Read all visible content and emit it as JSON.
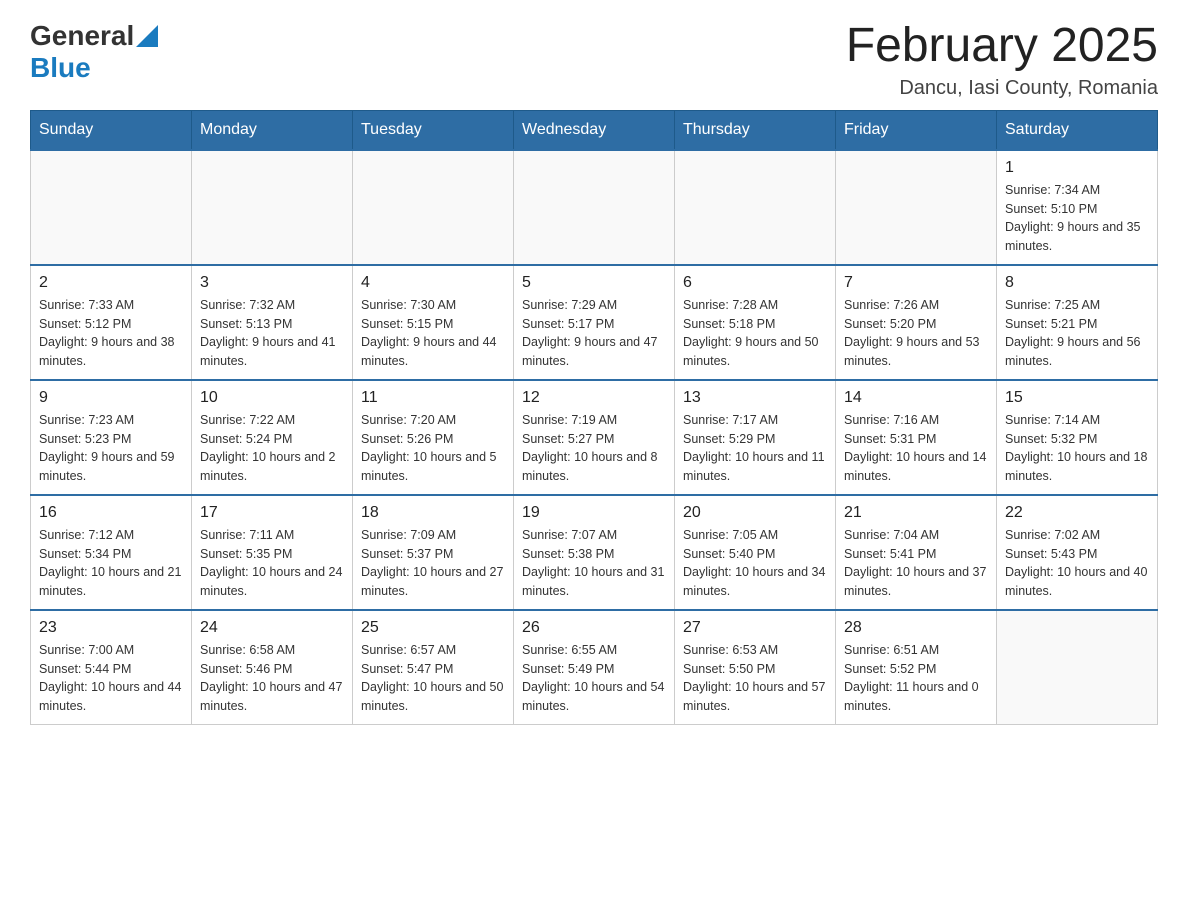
{
  "header": {
    "logo_general": "General",
    "logo_blue": "Blue",
    "title": "February 2025",
    "subtitle": "Dancu, Iasi County, Romania"
  },
  "days_of_week": [
    "Sunday",
    "Monday",
    "Tuesday",
    "Wednesday",
    "Thursday",
    "Friday",
    "Saturday"
  ],
  "weeks": [
    [
      {
        "day": "",
        "info": ""
      },
      {
        "day": "",
        "info": ""
      },
      {
        "day": "",
        "info": ""
      },
      {
        "day": "",
        "info": ""
      },
      {
        "day": "",
        "info": ""
      },
      {
        "day": "",
        "info": ""
      },
      {
        "day": "1",
        "info": "Sunrise: 7:34 AM\nSunset: 5:10 PM\nDaylight: 9 hours and 35 minutes."
      }
    ],
    [
      {
        "day": "2",
        "info": "Sunrise: 7:33 AM\nSunset: 5:12 PM\nDaylight: 9 hours and 38 minutes."
      },
      {
        "day": "3",
        "info": "Sunrise: 7:32 AM\nSunset: 5:13 PM\nDaylight: 9 hours and 41 minutes."
      },
      {
        "day": "4",
        "info": "Sunrise: 7:30 AM\nSunset: 5:15 PM\nDaylight: 9 hours and 44 minutes."
      },
      {
        "day": "5",
        "info": "Sunrise: 7:29 AM\nSunset: 5:17 PM\nDaylight: 9 hours and 47 minutes."
      },
      {
        "day": "6",
        "info": "Sunrise: 7:28 AM\nSunset: 5:18 PM\nDaylight: 9 hours and 50 minutes."
      },
      {
        "day": "7",
        "info": "Sunrise: 7:26 AM\nSunset: 5:20 PM\nDaylight: 9 hours and 53 minutes."
      },
      {
        "day": "8",
        "info": "Sunrise: 7:25 AM\nSunset: 5:21 PM\nDaylight: 9 hours and 56 minutes."
      }
    ],
    [
      {
        "day": "9",
        "info": "Sunrise: 7:23 AM\nSunset: 5:23 PM\nDaylight: 9 hours and 59 minutes."
      },
      {
        "day": "10",
        "info": "Sunrise: 7:22 AM\nSunset: 5:24 PM\nDaylight: 10 hours and 2 minutes."
      },
      {
        "day": "11",
        "info": "Sunrise: 7:20 AM\nSunset: 5:26 PM\nDaylight: 10 hours and 5 minutes."
      },
      {
        "day": "12",
        "info": "Sunrise: 7:19 AM\nSunset: 5:27 PM\nDaylight: 10 hours and 8 minutes."
      },
      {
        "day": "13",
        "info": "Sunrise: 7:17 AM\nSunset: 5:29 PM\nDaylight: 10 hours and 11 minutes."
      },
      {
        "day": "14",
        "info": "Sunrise: 7:16 AM\nSunset: 5:31 PM\nDaylight: 10 hours and 14 minutes."
      },
      {
        "day": "15",
        "info": "Sunrise: 7:14 AM\nSunset: 5:32 PM\nDaylight: 10 hours and 18 minutes."
      }
    ],
    [
      {
        "day": "16",
        "info": "Sunrise: 7:12 AM\nSunset: 5:34 PM\nDaylight: 10 hours and 21 minutes."
      },
      {
        "day": "17",
        "info": "Sunrise: 7:11 AM\nSunset: 5:35 PM\nDaylight: 10 hours and 24 minutes."
      },
      {
        "day": "18",
        "info": "Sunrise: 7:09 AM\nSunset: 5:37 PM\nDaylight: 10 hours and 27 minutes."
      },
      {
        "day": "19",
        "info": "Sunrise: 7:07 AM\nSunset: 5:38 PM\nDaylight: 10 hours and 31 minutes."
      },
      {
        "day": "20",
        "info": "Sunrise: 7:05 AM\nSunset: 5:40 PM\nDaylight: 10 hours and 34 minutes."
      },
      {
        "day": "21",
        "info": "Sunrise: 7:04 AM\nSunset: 5:41 PM\nDaylight: 10 hours and 37 minutes."
      },
      {
        "day": "22",
        "info": "Sunrise: 7:02 AM\nSunset: 5:43 PM\nDaylight: 10 hours and 40 minutes."
      }
    ],
    [
      {
        "day": "23",
        "info": "Sunrise: 7:00 AM\nSunset: 5:44 PM\nDaylight: 10 hours and 44 minutes."
      },
      {
        "day": "24",
        "info": "Sunrise: 6:58 AM\nSunset: 5:46 PM\nDaylight: 10 hours and 47 minutes."
      },
      {
        "day": "25",
        "info": "Sunrise: 6:57 AM\nSunset: 5:47 PM\nDaylight: 10 hours and 50 minutes."
      },
      {
        "day": "26",
        "info": "Sunrise: 6:55 AM\nSunset: 5:49 PM\nDaylight: 10 hours and 54 minutes."
      },
      {
        "day": "27",
        "info": "Sunrise: 6:53 AM\nSunset: 5:50 PM\nDaylight: 10 hours and 57 minutes."
      },
      {
        "day": "28",
        "info": "Sunrise: 6:51 AM\nSunset: 5:52 PM\nDaylight: 11 hours and 0 minutes."
      },
      {
        "day": "",
        "info": ""
      }
    ]
  ]
}
